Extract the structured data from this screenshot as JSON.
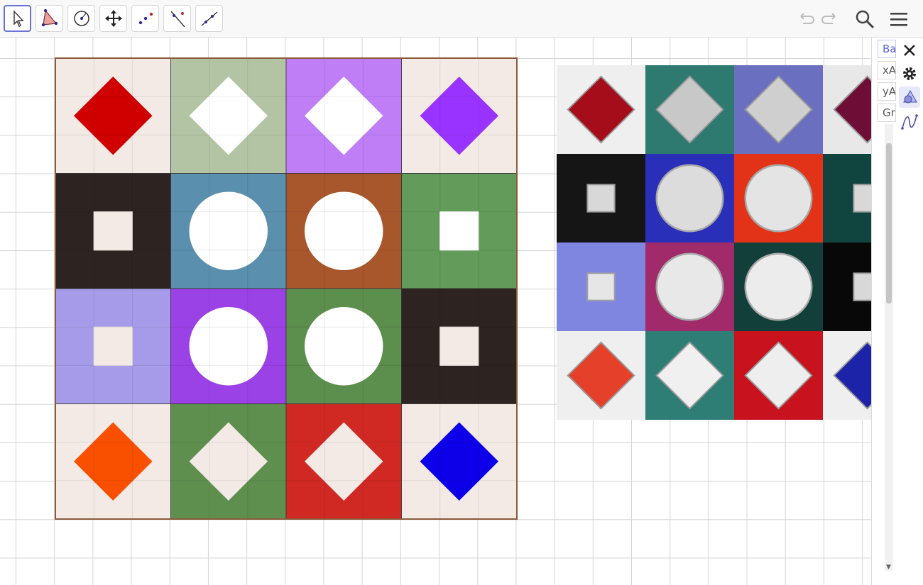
{
  "toolbar": {
    "tools": [
      {
        "name": "move-tool",
        "icon": "arrow-pointer-icon",
        "selected": true
      },
      {
        "name": "polygon-tool",
        "icon": "polygon-icon"
      },
      {
        "name": "circle-tool",
        "icon": "circle-center-icon"
      },
      {
        "name": "move-graphics-view-tool",
        "icon": "four-arrows-icon"
      },
      {
        "name": "point-tool",
        "icon": "points-icon"
      },
      {
        "name": "perpendicular-line-tool",
        "icon": "line-icon"
      },
      {
        "name": "segment-tool",
        "icon": "segment-icon"
      }
    ],
    "right": [
      "undo-icon",
      "redo-icon",
      "search-icon",
      "menu-icon"
    ]
  },
  "stylebar": {
    "buttons": [
      "axes-icon",
      "grid-icon",
      "home-icon",
      "magnet-icon",
      "settings-icon",
      "more-vert-icon",
      "toggle-stylebar-icon"
    ]
  },
  "algebra": {
    "entries": [
      "Ba",
      "xA",
      "yA",
      "Gr"
    ]
  },
  "colors": {
    "board_border": "#8a5a3a",
    "selected_tool_border": "#6b72d8",
    "grid_line": "#d4d4d4"
  },
  "board": {
    "rows": [
      [
        {
          "bg": "#f3eae6",
          "shape": "diamond",
          "fill": "#d00000"
        },
        {
          "bg": "#b2c4a3",
          "shape": "diamond",
          "fill": "#ffffff"
        },
        {
          "bg": "#bf7df6",
          "shape": "diamond",
          "fill": "#ffffff"
        },
        {
          "bg": "#f3eae6",
          "shape": "diamond",
          "fill": "#9933ff"
        }
      ],
      [
        {
          "bg": "#2d2320",
          "shape": "square",
          "fill": "#f3eae6"
        },
        {
          "bg": "#5a8fad",
          "shape": "circle",
          "fill": "#ffffff"
        },
        {
          "bg": "#a8562c",
          "shape": "circle",
          "fill": "#ffffff"
        },
        {
          "bg": "#629b5a",
          "shape": "square",
          "fill": "#ffffff"
        }
      ],
      [
        {
          "bg": "#a59be8",
          "shape": "square",
          "fill": "#f3eae6"
        },
        {
          "bg": "#9b42e6",
          "shape": "circle",
          "fill": "#ffffff"
        },
        {
          "bg": "#5c8e4e",
          "shape": "circle",
          "fill": "#ffffff"
        },
        {
          "bg": "#2d2320",
          "shape": "square",
          "fill": "#f3eae6"
        }
      ],
      [
        {
          "bg": "#f3eae6",
          "shape": "diamond",
          "fill": "#f95000"
        },
        {
          "bg": "#5e8f4f",
          "shape": "diamond",
          "fill": "#f3eae6"
        },
        {
          "bg": "#d02924",
          "shape": "diamond",
          "fill": "#f3eae6"
        },
        {
          "bg": "#f3eae6",
          "shape": "diamond",
          "fill": "#0d00e8"
        }
      ]
    ]
  },
  "photo": {
    "rows": [
      [
        {
          "bg": "#efefef",
          "shape": "diamond",
          "fill": "#a50d1a"
        },
        {
          "bg": "#2e7a70",
          "shape": "diamond",
          "fill": "#c8c8c8"
        },
        {
          "bg": "#6b6fc0",
          "shape": "diamond",
          "fill": "#cfcfcf"
        },
        {
          "bg": "#e8e8e8",
          "shape": "diamond",
          "fill": "#6e0d35"
        }
      ],
      [
        {
          "bg": "#151515",
          "shape": "square",
          "fill": "#d8d8d8"
        },
        {
          "bg": "#2a2fba",
          "shape": "circle",
          "fill": "#dcdcdc"
        },
        {
          "bg": "#e23318",
          "shape": "circle",
          "fill": "#e4e4e4"
        },
        {
          "bg": "#10443e",
          "shape": "square",
          "fill": "#d8d8d8"
        }
      ],
      [
        {
          "bg": "#7f86e0",
          "shape": "square",
          "fill": "#e6e6e6"
        },
        {
          "bg": "#a02a6a",
          "shape": "circle",
          "fill": "#e8e8e8"
        },
        {
          "bg": "#123f39",
          "shape": "circle",
          "fill": "#ececec"
        },
        {
          "bg": "#080808",
          "shape": "square",
          "fill": "#d8d8d8"
        }
      ],
      [
        {
          "bg": "#efefef",
          "shape": "diamond",
          "fill": "#e5412a"
        },
        {
          "bg": "#2e7e76",
          "shape": "diamond",
          "fill": "#f0f0f0"
        },
        {
          "bg": "#c8121e",
          "shape": "diamond",
          "fill": "#eeeeee"
        },
        {
          "bg": "#efefef",
          "shape": "diamond",
          "fill": "#1c23a8"
        }
      ]
    ]
  }
}
